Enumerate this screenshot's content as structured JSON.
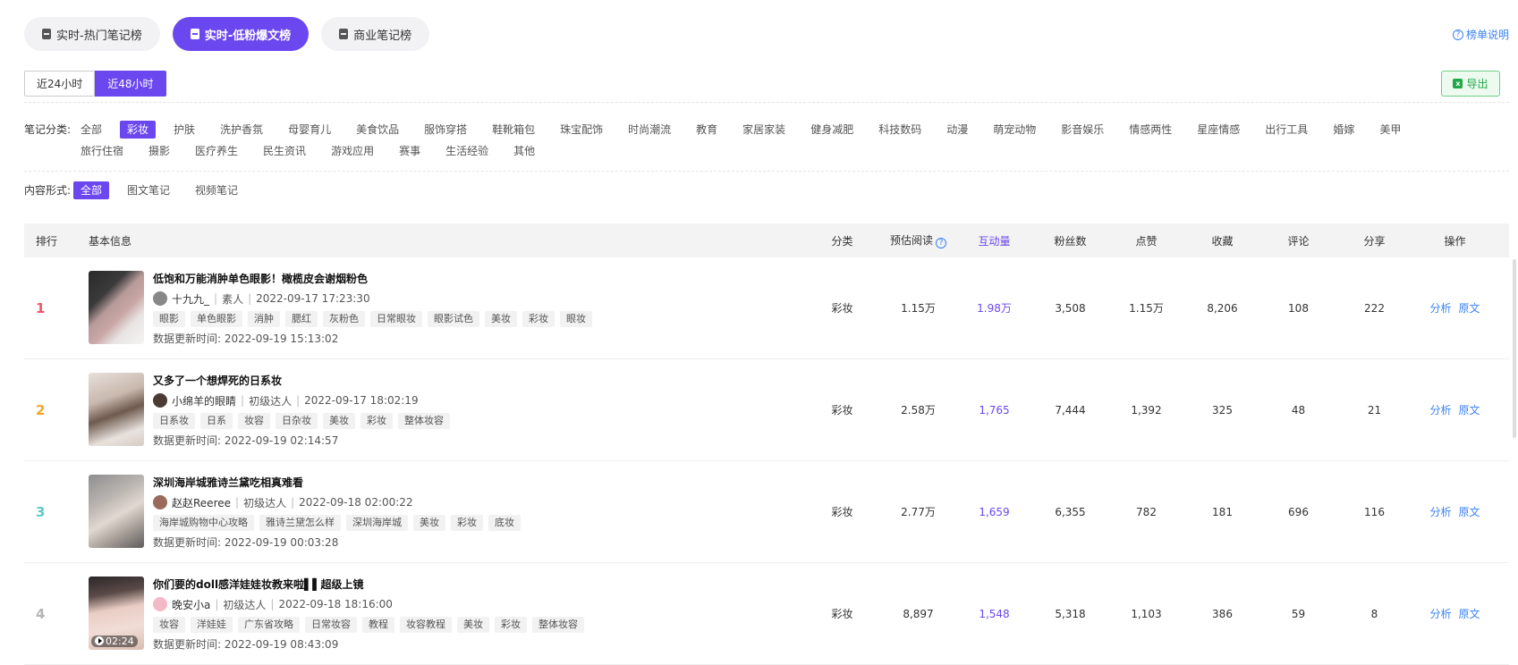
{
  "top_tabs": [
    {
      "label": "实时-热门笔记榜"
    },
    {
      "label": "实时-低粉爆文榜"
    },
    {
      "label": "商业笔记榜"
    }
  ],
  "help_link": "榜单说明",
  "time_toggle": [
    "近24小时",
    "近48小时"
  ],
  "export_label": "导出",
  "category_filter": {
    "label": "笔记分类:",
    "items": [
      "全部",
      "彩妆",
      "护肤",
      "洗护香氛",
      "母婴育儿",
      "美食饮品",
      "服饰穿搭",
      "鞋靴箱包",
      "珠宝配饰",
      "时尚潮流",
      "教育",
      "家居家装",
      "健身减肥",
      "科技数码",
      "动漫",
      "萌宠动物",
      "影音娱乐",
      "情感两性",
      "星座情感",
      "出行工具",
      "婚嫁",
      "美甲",
      "旅行住宿",
      "摄影",
      "医疗养生",
      "民生资讯",
      "游戏应用",
      "赛事",
      "生活经验",
      "其他"
    ],
    "selected": "彩妆"
  },
  "format_filter": {
    "label": "内容形式:",
    "items": [
      "全部",
      "图文笔记",
      "视频笔记"
    ],
    "selected": "全部"
  },
  "table": {
    "headers": {
      "rank": "排行",
      "info": "基本信息",
      "category": "分类",
      "est_read": "预估阅读",
      "interaction": "互动量",
      "fans": "粉丝数",
      "likes": "点赞",
      "collects": "收藏",
      "comments": "评论",
      "shares": "分享",
      "ops": "操作"
    },
    "op_analyze": "分析",
    "op_original": "原文",
    "update_prefix": "数据更新时间:",
    "rows": [
      {
        "rank": "1",
        "rank_color": "#f0566b",
        "title": "低饱和万能消肿单色眼影！橄榄皮会谢烟粉色",
        "author": "十九九_",
        "level": "素人",
        "published": "2022-09-17 17:23:30",
        "tags": [
          "眼影",
          "单色眼影",
          "消肿",
          "腮红",
          "灰粉色",
          "日常眼妆",
          "眼影试色",
          "美妆",
          "彩妆",
          "眼妆"
        ],
        "updated": "2022-09-19 15:13:02",
        "category": "彩妆",
        "est_read": "1.15万",
        "interaction": "1.98万",
        "fans": "3,508",
        "likes": "1.15万",
        "collects": "8,206",
        "comments": "108",
        "shares": "222",
        "video_duration": ""
      },
      {
        "rank": "2",
        "rank_color": "#f5a623",
        "title": "又多了一个想焊死的日系妆",
        "author": "小绵羊的眼睛",
        "level": "初级达人",
        "published": "2022-09-17 18:02:19",
        "tags": [
          "日系妆",
          "日系",
          "妆容",
          "日杂妆",
          "美妆",
          "彩妆",
          "整体妆容"
        ],
        "updated": "2022-09-19 02:14:57",
        "category": "彩妆",
        "est_read": "2.58万",
        "interaction": "1,765",
        "fans": "7,444",
        "likes": "1,392",
        "collects": "325",
        "comments": "48",
        "shares": "21",
        "video_duration": ""
      },
      {
        "rank": "3",
        "rank_color": "#5cc9c9",
        "title": "深圳海岸城雅诗兰黛吃相真难看",
        "author": "赵赵Reeree",
        "level": "初级达人",
        "published": "2022-09-18 02:00:22",
        "tags": [
          "海岸城购物中心攻略",
          "雅诗兰黛怎么样",
          "深圳海岸城",
          "美妆",
          "彩妆",
          "底妆"
        ],
        "updated": "2022-09-19 00:03:28",
        "category": "彩妆",
        "est_read": "2.77万",
        "interaction": "1,659",
        "fans": "6,355",
        "likes": "782",
        "collects": "181",
        "comments": "696",
        "shares": "116",
        "video_duration": ""
      },
      {
        "rank": "4",
        "rank_color": "#b5b5b5",
        "title": "你们要的doll感洋娃娃妆教来啦▌▌超级上镜",
        "author": "晚安小a",
        "level": "初级达人",
        "published": "2022-09-18 18:16:00",
        "tags": [
          "妆容",
          "洋娃娃",
          "广东省攻略",
          "日常妆容",
          "教程",
          "妆容教程",
          "美妆",
          "彩妆",
          "整体妆容"
        ],
        "updated": "2022-09-19 08:43:09",
        "category": "彩妆",
        "est_read": "8,897",
        "interaction": "1,548",
        "fans": "5,318",
        "likes": "1,103",
        "collects": "386",
        "comments": "59",
        "shares": "8",
        "video_duration": "02:24"
      }
    ]
  },
  "colors": {
    "accent": "#6b47f0",
    "link": "#3b82f6",
    "export_green": "#23a649"
  }
}
